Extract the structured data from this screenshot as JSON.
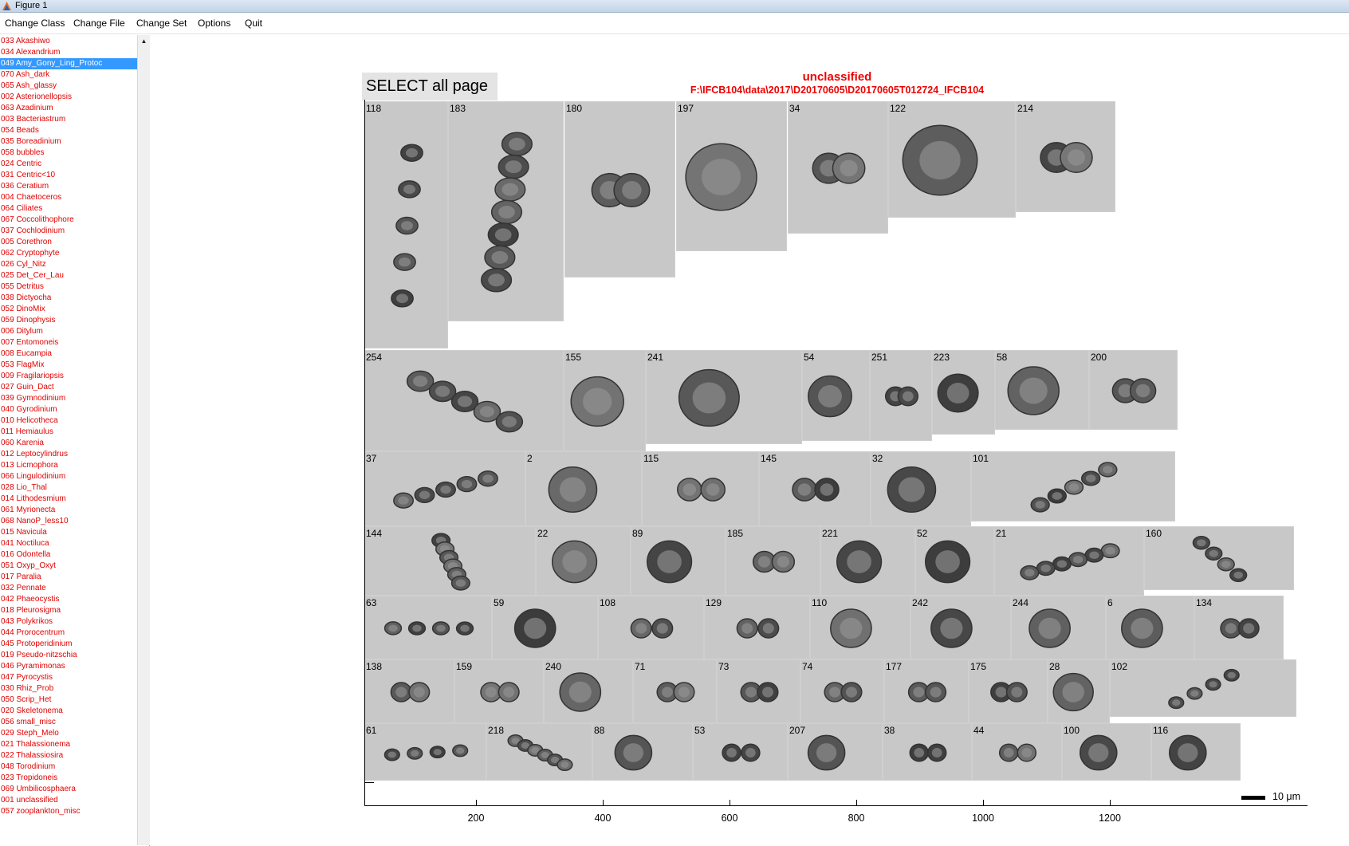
{
  "window": {
    "title": "Figure 1"
  },
  "menu": [
    "Change Class",
    "Change File",
    "Change Set",
    "Options",
    "Quit"
  ],
  "class_list": {
    "selected_index": 2,
    "items": [
      "033 Akashiwo",
      "034 Alexandrium",
      "049 Amy_Gony_Ling_Protoc",
      "070 Ash_dark",
      "065 Ash_glassy",
      "002 Asterionellopsis",
      "063 Azadinium",
      "003 Bacteriastrum",
      "054 Beads",
      "035 Boreadinium",
      "058 bubbles",
      "024 Centric",
      "031 Centric<10",
      "036 Ceratium",
      "004 Chaetoceros",
      "064 Ciliates",
      "067 Coccolithophore",
      "037 Cochlodinium",
      "005 Corethron",
      "062 Cryptophyte",
      "026 Cyl_Nitz",
      "025 Det_Cer_Lau",
      "055 Detritus",
      "038 Dictyocha",
      "052 DinoMix",
      "059 Dinophysis",
      "006 Ditylum",
      "007 Entomoneis",
      "008 Eucampia",
      "053 FlagMix",
      "009 Fragilariopsis",
      "027 Guin_Dact",
      "039 Gymnodinium",
      "040 Gyrodinium",
      "010 Helicotheca",
      "011 Hemiaulus",
      "060 Karenia",
      "012 Leptocylindrus",
      "013 Licmophora",
      "066 Lingulodinium",
      "028 Lio_Thal",
      "014 Lithodesmium",
      "061 Myrionecta",
      "068 NanoP_less10",
      "015 Navicula",
      "041 Noctiluca",
      "016 Odontella",
      "051 Oxyp_Oxyt",
      "017 Paralia",
      "032 Pennate",
      "042 Phaeocystis",
      "018 Pleurosigma",
      "043 Polykrikos",
      "044 Prorocentrum",
      "045 Protoperidinium",
      "019 Pseudo-nitzschia",
      "046 Pyramimonas",
      "047 Pyrocystis",
      "030 Rhiz_Prob",
      "050 Scrip_Het",
      "020 Skeletonema",
      "056 small_misc",
      "029 Steph_Melo",
      "021 Thalassionema",
      "022 Thalassiosira",
      "048 Torodinium",
      "023 Tropidoneis",
      "069 Umbilicosphaera",
      "001 unclassified",
      "057 zooplankton_misc"
    ]
  },
  "select_button": "SELECT all page",
  "plot": {
    "class_title": "unclassified",
    "file_path": "F:\\IFCB104\\data\\2017\\D20170605\\D20170605T012724_IFCB104",
    "x_ticks": [
      "200",
      "400",
      "600",
      "800",
      "1000",
      "1200"
    ],
    "scale_label": "10 μm",
    "rows": [
      [
        "118",
        "183",
        "180",
        "197",
        "34",
        "122",
        "214"
      ],
      [
        "254",
        "155",
        "241",
        "54",
        "251",
        "223",
        "58",
        "200"
      ],
      [
        "37",
        "2",
        "115",
        "145",
        "32",
        "101"
      ],
      [
        "144",
        "22",
        "89",
        "185",
        "221",
        "52",
        "21",
        "160"
      ],
      [
        "63",
        "59",
        "108",
        "129",
        "110",
        "242",
        "244",
        "6",
        "134"
      ],
      [
        "138",
        "159",
        "240",
        "71",
        "73",
        "74",
        "177",
        "175",
        "28",
        "102"
      ],
      [
        "61",
        "218",
        "88",
        "53",
        "207",
        "38",
        "44",
        "100",
        "116"
      ]
    ]
  },
  "colors": {
    "class_text": "#e10000",
    "selection": "#3399ff",
    "title_red": "#e00000",
    "tile_bg": "#c8c8c8"
  }
}
